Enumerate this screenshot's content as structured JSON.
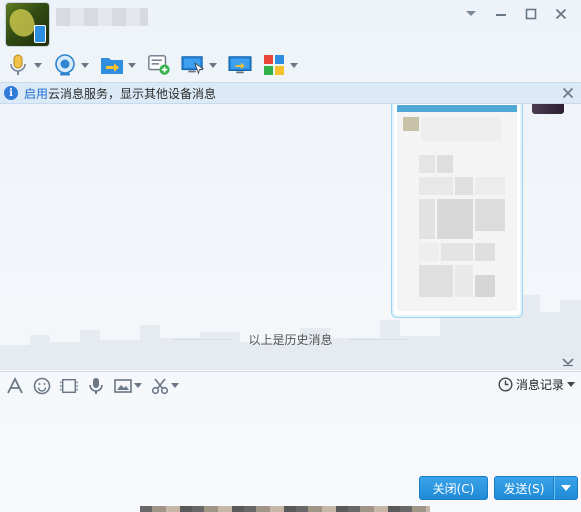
{
  "window": {
    "accent_color": "#1f8ad8",
    "notice_bg": "#dce9f7"
  },
  "titlebar": {
    "contact_name": "",
    "controls": [
      {
        "name": "menu-dropdown-icon"
      },
      {
        "name": "minimize-icon"
      },
      {
        "name": "maximize-icon"
      },
      {
        "name": "close-icon"
      }
    ]
  },
  "toolbar": {
    "tools": [
      {
        "name": "voice-call-icon",
        "has_dropdown": true
      },
      {
        "name": "video-call-icon",
        "has_dropdown": true
      },
      {
        "name": "send-file-icon",
        "has_dropdown": true
      },
      {
        "name": "create-discussion-icon",
        "has_dropdown": false
      },
      {
        "name": "remote-assist-icon",
        "has_dropdown": true
      },
      {
        "name": "screen-share-icon",
        "has_dropdown": false
      },
      {
        "name": "apps-icon",
        "has_dropdown": true
      }
    ]
  },
  "notice": {
    "link": "启用",
    "message": "云消息服务，显示其他设备消息"
  },
  "chat": {
    "history_separator": "以上是历史消息"
  },
  "input_toolbar": {
    "tools": [
      {
        "name": "font-icon"
      },
      {
        "name": "emoji-icon"
      },
      {
        "name": "gif-icon"
      },
      {
        "name": "voice-message-icon"
      },
      {
        "name": "image-icon"
      },
      {
        "name": "screenshot-icon"
      }
    ],
    "history_label": "消息记录"
  },
  "buttons": {
    "close_label": "关闭(C)",
    "send_label": "发送(S)"
  }
}
